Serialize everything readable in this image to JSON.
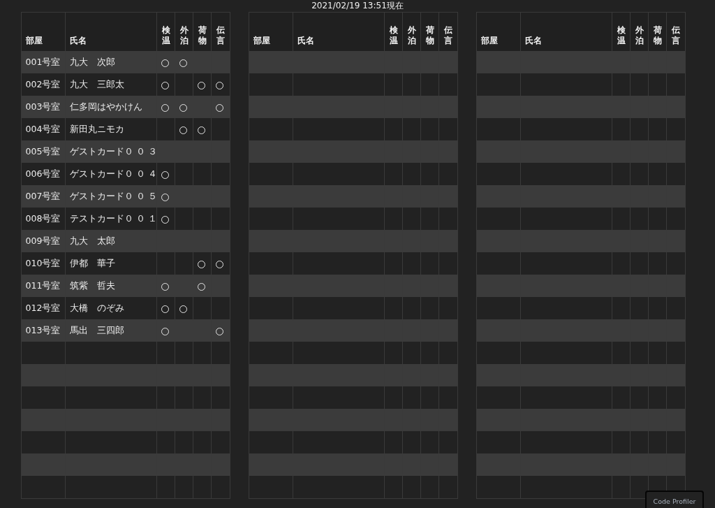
{
  "title": "2021/02/19 13:51現在",
  "tables": [
    {
      "columns": [
        {
          "kind": "room",
          "label": "部屋"
        },
        {
          "kind": "name",
          "label": "氏名"
        },
        {
          "kind": "check",
          "label": "検温"
        },
        {
          "kind": "check",
          "label": "外泊"
        },
        {
          "kind": "check",
          "label": "荷物"
        },
        {
          "kind": "check",
          "label": "伝言"
        }
      ],
      "rows": [
        {
          "room": "001号室",
          "name": "九大　次郎",
          "checks": [
            true,
            true,
            false,
            false
          ]
        },
        {
          "room": "002号室",
          "name": "九大　三郎太",
          "checks": [
            true,
            false,
            true,
            true
          ]
        },
        {
          "room": "003号室",
          "name": "仁多岡はやかけん",
          "checks": [
            true,
            true,
            false,
            true
          ]
        },
        {
          "room": "004号室",
          "name": "新田丸ニモカ",
          "checks": [
            false,
            true,
            true,
            false
          ]
        },
        {
          "room": "005号室",
          "name": "ゲストカード０ ０ ３",
          "checks": [
            false,
            false,
            false,
            false
          ]
        },
        {
          "room": "006号室",
          "name": "ゲストカード０ ０ ４",
          "checks": [
            true,
            false,
            false,
            false
          ]
        },
        {
          "room": "007号室",
          "name": "ゲストカード０ ０ ５",
          "checks": [
            true,
            false,
            false,
            false
          ]
        },
        {
          "room": "008号室",
          "name": "テストカード０ ０ １",
          "checks": [
            true,
            false,
            false,
            false
          ]
        },
        {
          "room": "009号室",
          "name": "九大　太郎",
          "checks": [
            false,
            false,
            false,
            false
          ]
        },
        {
          "room": "010号室",
          "name": "伊都　華子",
          "checks": [
            false,
            false,
            true,
            true
          ]
        },
        {
          "room": "011号室",
          "name": "筑紫　哲夫",
          "checks": [
            true,
            false,
            true,
            false
          ]
        },
        {
          "room": "012号室",
          "name": "大橋　のぞみ",
          "checks": [
            true,
            true,
            false,
            false
          ]
        },
        {
          "room": "013号室",
          "name": "馬出　三四郎",
          "checks": [
            true,
            false,
            false,
            true
          ]
        },
        {
          "checks": [
            false,
            false,
            false,
            false
          ]
        },
        {
          "checks": [
            false,
            false,
            false,
            false
          ]
        },
        {
          "checks": [
            false,
            false,
            false,
            false
          ]
        },
        {
          "checks": [
            false,
            false,
            false,
            false
          ]
        },
        {
          "checks": [
            false,
            false,
            false,
            false
          ]
        },
        {
          "checks": [
            false,
            false,
            false,
            false
          ]
        },
        {
          "checks": [
            false,
            false,
            false,
            false
          ]
        }
      ]
    },
    {
      "columns": [
        {
          "kind": "room",
          "label": "部屋"
        },
        {
          "kind": "name",
          "label": "氏名"
        },
        {
          "kind": "check",
          "label": "検温"
        },
        {
          "kind": "check",
          "label": "外泊"
        },
        {
          "kind": "check",
          "label": "荷物"
        },
        {
          "kind": "check",
          "label": "伝言"
        }
      ],
      "rows": [
        {
          "checks": [
            false,
            false,
            false,
            false
          ]
        },
        {
          "checks": [
            false,
            false,
            false,
            false
          ]
        },
        {
          "checks": [
            false,
            false,
            false,
            false
          ]
        },
        {
          "checks": [
            false,
            false,
            false,
            false
          ]
        },
        {
          "checks": [
            false,
            false,
            false,
            false
          ]
        },
        {
          "checks": [
            false,
            false,
            false,
            false
          ]
        },
        {
          "checks": [
            false,
            false,
            false,
            false
          ]
        },
        {
          "checks": [
            false,
            false,
            false,
            false
          ]
        },
        {
          "checks": [
            false,
            false,
            false,
            false
          ]
        },
        {
          "checks": [
            false,
            false,
            false,
            false
          ]
        },
        {
          "checks": [
            false,
            false,
            false,
            false
          ]
        },
        {
          "checks": [
            false,
            false,
            false,
            false
          ]
        },
        {
          "checks": [
            false,
            false,
            false,
            false
          ]
        },
        {
          "checks": [
            false,
            false,
            false,
            false
          ]
        },
        {
          "checks": [
            false,
            false,
            false,
            false
          ]
        },
        {
          "checks": [
            false,
            false,
            false,
            false
          ]
        },
        {
          "checks": [
            false,
            false,
            false,
            false
          ]
        },
        {
          "checks": [
            false,
            false,
            false,
            false
          ]
        },
        {
          "checks": [
            false,
            false,
            false,
            false
          ]
        },
        {
          "checks": [
            false,
            false,
            false,
            false
          ]
        }
      ]
    },
    {
      "columns": [
        {
          "kind": "room",
          "label": "部屋"
        },
        {
          "kind": "name",
          "label": "氏名"
        },
        {
          "kind": "check",
          "label": "検温"
        },
        {
          "kind": "check",
          "label": "外泊"
        },
        {
          "kind": "check",
          "label": "荷物"
        },
        {
          "kind": "check",
          "label": "伝言"
        }
      ],
      "rows": [
        {
          "checks": [
            false,
            false,
            false,
            false
          ]
        },
        {
          "checks": [
            false,
            false,
            false,
            false
          ]
        },
        {
          "checks": [
            false,
            false,
            false,
            false
          ]
        },
        {
          "checks": [
            false,
            false,
            false,
            false
          ]
        },
        {
          "checks": [
            false,
            false,
            false,
            false
          ]
        },
        {
          "checks": [
            false,
            false,
            false,
            false
          ]
        },
        {
          "checks": [
            false,
            false,
            false,
            false
          ]
        },
        {
          "checks": [
            false,
            false,
            false,
            false
          ]
        },
        {
          "checks": [
            false,
            false,
            false,
            false
          ]
        },
        {
          "checks": [
            false,
            false,
            false,
            false
          ]
        },
        {
          "checks": [
            false,
            false,
            false,
            false
          ]
        },
        {
          "checks": [
            false,
            false,
            false,
            false
          ]
        },
        {
          "checks": [
            false,
            false,
            false,
            false
          ]
        },
        {
          "checks": [
            false,
            false,
            false,
            false
          ]
        },
        {
          "checks": [
            false,
            false,
            false,
            false
          ]
        },
        {
          "checks": [
            false,
            false,
            false,
            false
          ]
        },
        {
          "checks": [
            false,
            false,
            false,
            false
          ]
        },
        {
          "checks": [
            false,
            false,
            false,
            false
          ]
        },
        {
          "checks": [
            false,
            false,
            false,
            false
          ]
        },
        {
          "checks": [
            false,
            false,
            false,
            false
          ]
        }
      ]
    }
  ],
  "profiler_tab": "Code Profiler"
}
